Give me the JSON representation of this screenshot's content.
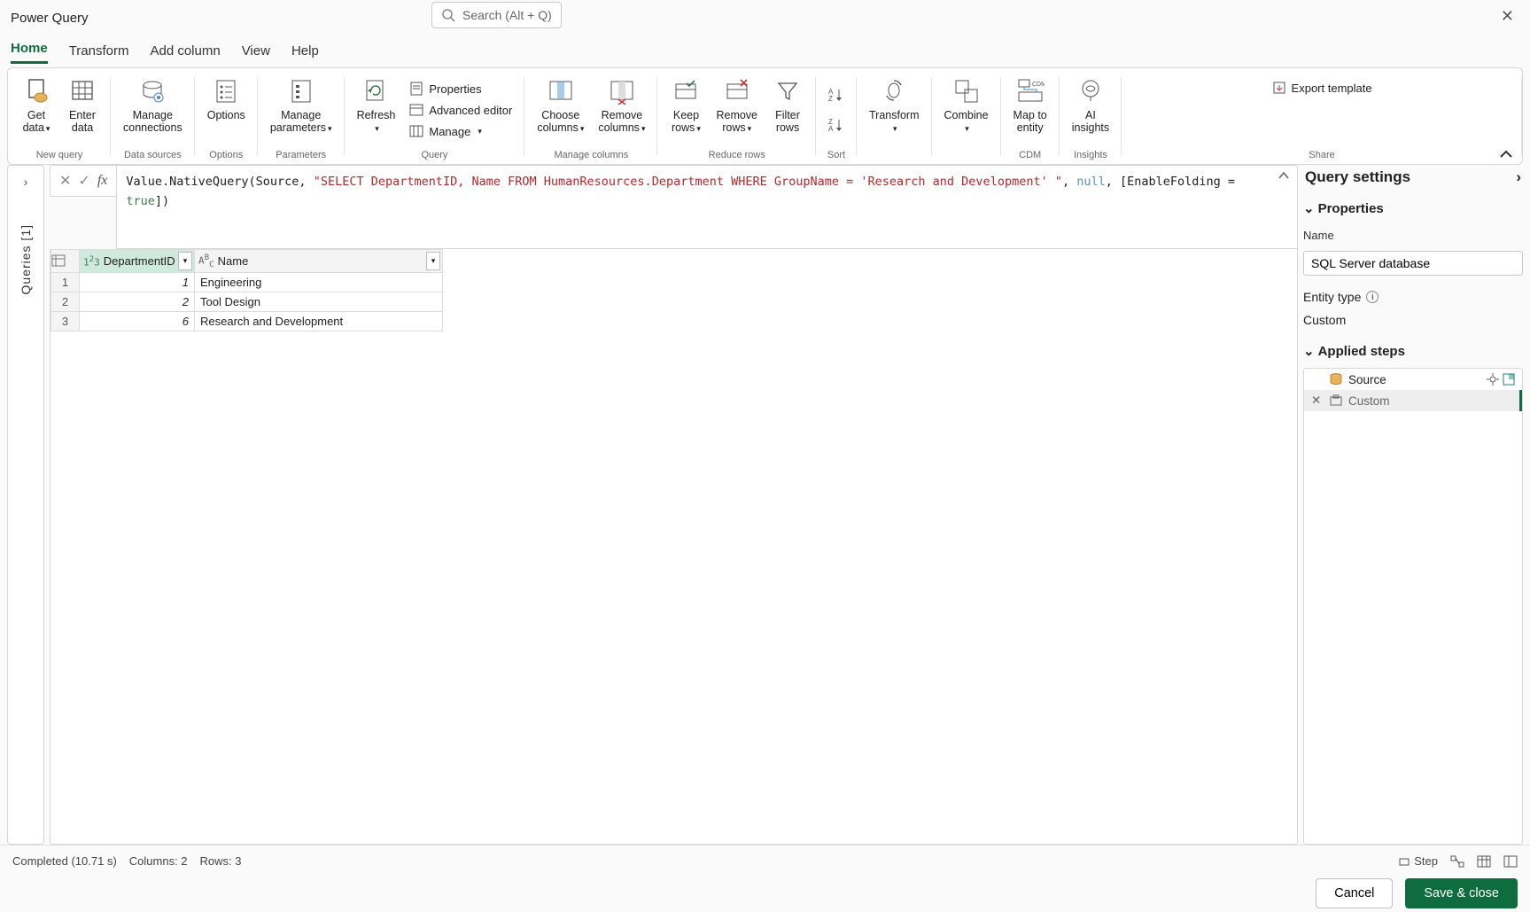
{
  "app_title": "Power Query",
  "search_placeholder": "Search (Alt + Q)",
  "ribbon_tabs": [
    "Home",
    "Transform",
    "Add column",
    "View",
    "Help"
  ],
  "ribbon_groups": {
    "new_query": {
      "label": "New query",
      "get_data": "Get\ndata",
      "enter_data": "Enter\ndata"
    },
    "data_sources": {
      "label": "Data sources",
      "manage_connections": "Manage\nconnections"
    },
    "options_grp": {
      "label": "Options",
      "options": "Options"
    },
    "parameters": {
      "label": "Parameters",
      "manage_parameters": "Manage\nparameters"
    },
    "query": {
      "label": "Query",
      "refresh": "Refresh",
      "properties": "Properties",
      "advanced_editor": "Advanced editor",
      "manage": "Manage"
    },
    "manage_columns": {
      "label": "Manage columns",
      "choose": "Choose\ncolumns",
      "remove": "Remove\ncolumns"
    },
    "reduce_rows": {
      "label": "Reduce rows",
      "keep": "Keep\nrows",
      "remove": "Remove\nrows",
      "filter": "Filter\nrows"
    },
    "sort": {
      "label": "Sort"
    },
    "transform": {
      "label": "",
      "transform": "Transform"
    },
    "combine": {
      "label": "",
      "combine": "Combine"
    },
    "cdm": {
      "label": "CDM",
      "map": "Map to\nentity"
    },
    "insights": {
      "label": "Insights",
      "ai": "AI\ninsights"
    },
    "share": {
      "label": "Share",
      "export": "Export template"
    }
  },
  "queries_rail": "Queries [1]",
  "formula": {
    "p1": "Value.NativeQuery(Source, ",
    "str": "\"SELECT DepartmentID, Name FROM HumanResources.Department WHERE GroupName = 'Research and Development'  \"",
    "p2": ", ",
    "null_tok": "null",
    "p3": ", [EnableFolding = ",
    "true_tok": "true",
    "p4": "])"
  },
  "grid": {
    "columns": [
      "DepartmentID",
      "Name"
    ],
    "rows": [
      {
        "n": 1,
        "DepartmentID": "1",
        "Name": "Engineering"
      },
      {
        "n": 2,
        "DepartmentID": "2",
        "Name": "Tool Design"
      },
      {
        "n": 3,
        "DepartmentID": "6",
        "Name": "Research and Development"
      }
    ]
  },
  "settings": {
    "title": "Query settings",
    "properties": "Properties",
    "name_label": "Name",
    "name_value": "SQL Server database",
    "entity_type_label": "Entity type",
    "entity_type_value": "Custom",
    "applied_steps": "Applied steps",
    "steps": [
      {
        "name": "Source",
        "selected": false,
        "icons": [
          "gear",
          "fx"
        ]
      },
      {
        "name": "Custom",
        "selected": true,
        "icons": []
      }
    ]
  },
  "status": {
    "completed": "Completed (10.71 s)",
    "columns": "Columns: 2",
    "rows": "Rows: 3",
    "step": "Step"
  },
  "footer": {
    "cancel": "Cancel",
    "save": "Save & close"
  }
}
